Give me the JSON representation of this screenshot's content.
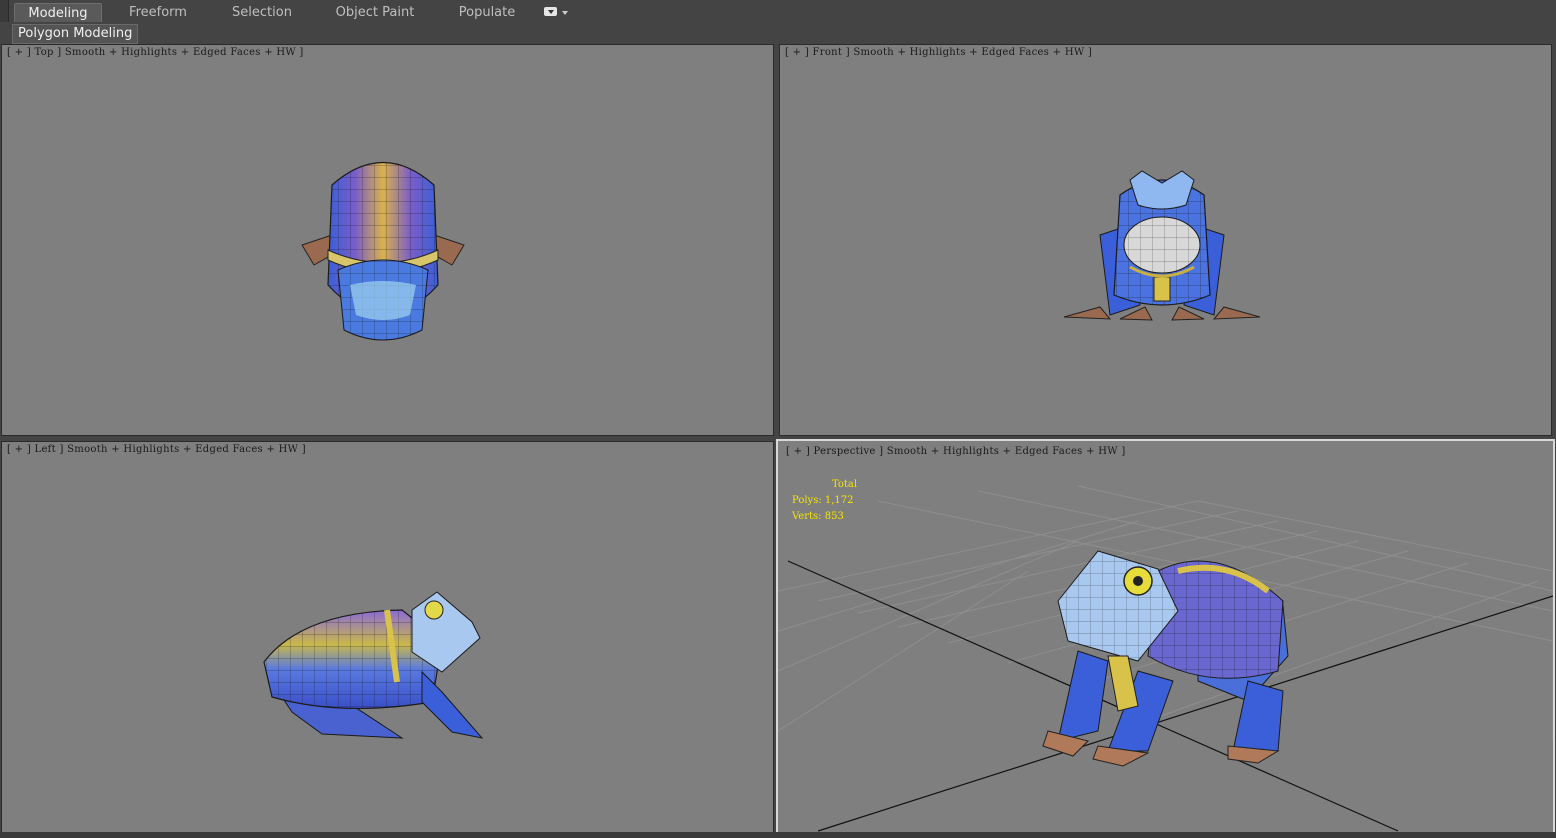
{
  "ribbon": {
    "tabs": [
      "Modeling",
      "Freeform",
      "Selection",
      "Object Paint",
      "Populate"
    ],
    "active_tab": "Modeling",
    "panel_label": "Polygon Modeling"
  },
  "viewports": {
    "top": {
      "label": "[ + ] Top ] Smooth + Highlights + Edged Faces + HW ]"
    },
    "front": {
      "label": "[ + ] Front ] Smooth + Highlights + Edged Faces + HW ]"
    },
    "left": {
      "label": "[ + ] Left ] Smooth + Highlights + Edged Faces + HW ]"
    },
    "perspective": {
      "label": "[ + ] Perspective ] Smooth + Highlights + Edged Faces + HW ]",
      "stats": {
        "title": "Total",
        "polys_label": "Polys:",
        "polys": "1,172",
        "verts_label": "Verts:",
        "verts": "853"
      }
    }
  },
  "colors": {
    "viewport_bg": "#7f7f7f",
    "ui_bg": "#444444",
    "stats_text": "#f5e400",
    "frog_blue": "#3a5fd8",
    "frog_purple": "#7a5ec8",
    "frog_yellow": "#d9c24a",
    "frog_skin": "#b07a5a"
  },
  "icons": [
    "dropdown-icon",
    "chevron-down-icon"
  ]
}
